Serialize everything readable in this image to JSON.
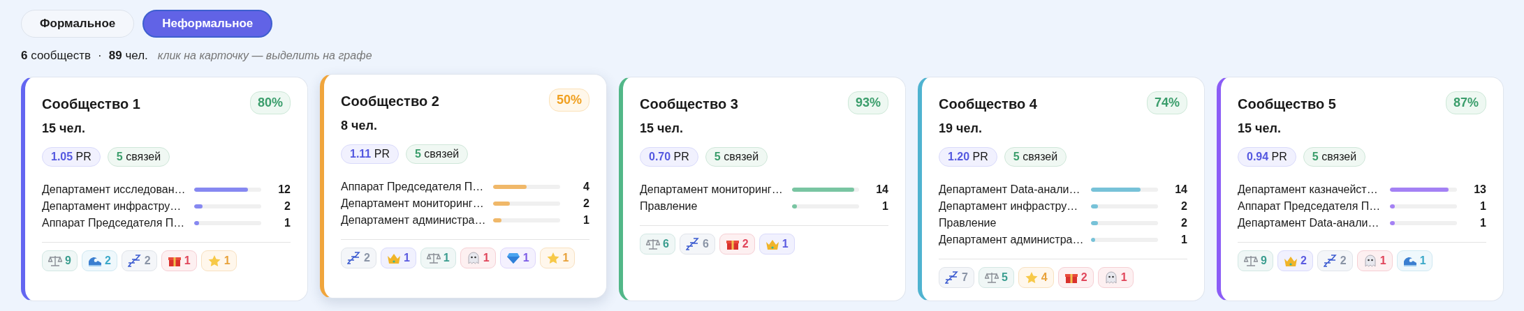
{
  "tabs": [
    {
      "label": "Формальное",
      "selected": false
    },
    {
      "label": "Неформальное",
      "selected": true
    }
  ],
  "summary": {
    "communities": "**6** сообществ",
    "separator": "·",
    "people": "**89** чел.",
    "hint": "клик на карточку — выделить на графе"
  },
  "cards": [
    {
      "title": "Сообщество 1",
      "percent": {
        "text": "80%",
        "kind": "good"
      },
      "members": "15 чел.",
      "pr": "**1.05** PR",
      "links": "**5** связей",
      "color": "#6366f1",
      "selected": false,
      "departments": [
        {
          "name": "Департамент исследован…",
          "count": "12",
          "level": 0.8
        },
        {
          "name": "Департамент инфрастру…",
          "count": "2",
          "level": 0.13
        },
        {
          "name": "Аппарат Председателя П…",
          "count": "1",
          "level": 0.07
        }
      ],
      "badges": [
        {
          "kind": "scales",
          "count": "9"
        },
        {
          "kind": "wave",
          "count": "2"
        },
        {
          "kind": "sleep",
          "count": "2"
        },
        {
          "kind": "gift",
          "count": "1"
        },
        {
          "kind": "star",
          "count": "1"
        }
      ]
    },
    {
      "title": "Сообщество 2",
      "percent": {
        "text": "50%",
        "kind": "warn"
      },
      "members": "8 чел.",
      "pr": "**1.11** PR",
      "links": "**5** связей",
      "color": "#f0a53c",
      "selected": true,
      "departments": [
        {
          "name": "Аппарат Председателя П…",
          "count": "4",
          "level": 0.5
        },
        {
          "name": "Департамент мониторинг…",
          "count": "2",
          "level": 0.25
        },
        {
          "name": "Департамент администра…",
          "count": "1",
          "level": 0.12
        }
      ],
      "badges": [
        {
          "kind": "sleep",
          "count": "2"
        },
        {
          "kind": "crown",
          "count": "1"
        },
        {
          "kind": "scales",
          "count": "1"
        },
        {
          "kind": "ghost",
          "count": "1"
        },
        {
          "kind": "gem",
          "count": "1"
        },
        {
          "kind": "star",
          "count": "1"
        }
      ]
    },
    {
      "title": "Сообщество 3",
      "percent": {
        "text": "93%",
        "kind": "good"
      },
      "members": "15 чел.",
      "pr": "**0.70** PR",
      "links": "**5** связей",
      "color": "#52b788",
      "selected": false,
      "departments": [
        {
          "name": "Департамент мониторинг…",
          "count": "14",
          "level": 0.93
        },
        {
          "name": "Правление",
          "count": "1",
          "level": 0.07
        }
      ],
      "badges": [
        {
          "kind": "scales",
          "count": "6"
        },
        {
          "kind": "sleep",
          "count": "6"
        },
        {
          "kind": "gift",
          "count": "2"
        },
        {
          "kind": "crown",
          "count": "1"
        }
      ]
    },
    {
      "title": "Сообщество 4",
      "percent": {
        "text": "74%",
        "kind": "good"
      },
      "members": "19 чел.",
      "pr": "**1.20** PR",
      "links": "**5** связей",
      "color": "#4fb3d0",
      "selected": false,
      "departments": [
        {
          "name": "Департамент Data-анали…",
          "count": "14",
          "level": 0.74
        },
        {
          "name": "Департамент инфрастру…",
          "count": "2",
          "level": 0.1
        },
        {
          "name": "Правление",
          "count": "2",
          "level": 0.1
        },
        {
          "name": "Департамент администра…",
          "count": "1",
          "level": 0.05
        }
      ],
      "badges": [
        {
          "kind": "sleep",
          "count": "7"
        },
        {
          "kind": "scales",
          "count": "5"
        },
        {
          "kind": "star",
          "count": "4"
        },
        {
          "kind": "gift",
          "count": "2"
        },
        {
          "kind": "ghost",
          "count": "1"
        }
      ]
    },
    {
      "title": "Сообщество 5",
      "percent": {
        "text": "87%",
        "kind": "good"
      },
      "members": "15 чел.",
      "pr": "**0.94** PR",
      "links": "**5** связей",
      "color": "#8b5cf6",
      "selected": false,
      "departments": [
        {
          "name": "Департамент казначейст…",
          "count": "13",
          "level": 0.87
        },
        {
          "name": "Аппарат Председателя П…",
          "count": "1",
          "level": 0.07
        },
        {
          "name": "Департамент Data-анали…",
          "count": "1",
          "level": 0.07
        }
      ],
      "badges": [
        {
          "kind": "scales",
          "count": "9"
        },
        {
          "kind": "crown",
          "count": "2"
        },
        {
          "kind": "sleep",
          "count": "2"
        },
        {
          "kind": "ghost",
          "count": "1"
        },
        {
          "kind": "wave",
          "count": "1"
        }
      ]
    }
  ]
}
